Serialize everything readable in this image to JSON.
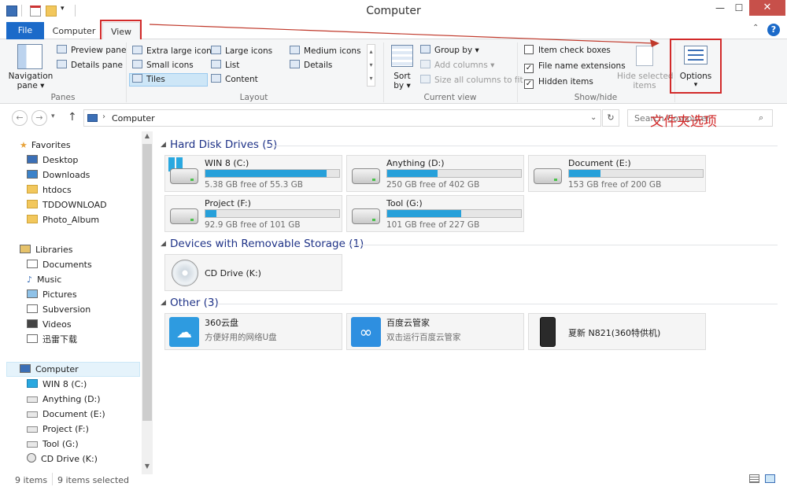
{
  "window": {
    "title": "Computer"
  },
  "tabs": {
    "file": "File",
    "computer": "Computer",
    "view": "View"
  },
  "ribbon": {
    "panes": {
      "navigation_pane": "Navigation",
      "navigation_pane_2": "pane ▾",
      "preview_pane": "Preview pane",
      "details_pane": "Details pane",
      "label": "Panes"
    },
    "layout": {
      "items": [
        "Extra large icons",
        "Large icons",
        "Medium icons",
        "Small icons",
        "List",
        "Details",
        "Tiles",
        "Content"
      ],
      "label": "Layout"
    },
    "current_view": {
      "sort_by": "Sort",
      "sort_by_2": "by ▾",
      "group_by": "Group by ▾",
      "add_columns": "Add columns ▾",
      "size_columns": "Size all columns to fit",
      "label": "Current view"
    },
    "show_hide": {
      "item_check_boxes": "Item check boxes",
      "file_name_extensions": "File name extensions",
      "hidden_items": "Hidden items",
      "hide_selected": "Hide selected",
      "hide_selected_2": "items",
      "label": "Show/hide",
      "checks": {
        "item_check_boxes": "",
        "file_name_extensions": "✓",
        "hidden_items": "✓"
      }
    },
    "options": {
      "label": "Options",
      "arrow": "▾"
    }
  },
  "annotation": {
    "options_label": "文件夹选项"
  },
  "address": {
    "path": "Computer",
    "search_placeholder": "Search Computer"
  },
  "nav": {
    "favorites": "Favorites",
    "desktop": "Desktop",
    "downloads": "Downloads",
    "htdocs": "htdocs",
    "tddownload": "TDDOWNLOAD",
    "photo_album": "Photo_Album",
    "libraries": "Libraries",
    "documents": "Documents",
    "music": "Music",
    "pictures": "Pictures",
    "subversion": "Subversion",
    "videos": "Videos",
    "thunder": "迅雷下载",
    "computer": "Computer",
    "win8": "WIN 8 (C:)",
    "anything": "Anything (D:)",
    "document": "Document (E:)",
    "project": "Project (F:)",
    "tool": "Tool (G:)",
    "cd": "CD Drive (K:)"
  },
  "sections": {
    "hdd": "Hard Disk Drives (5)",
    "removable": "Devices with Removable Storage (1)",
    "other": "Other (3)"
  },
  "drives": [
    {
      "name": "WIN 8 (C:)",
      "free": "5.38 GB free of 55.3 GB",
      "used_fraction": 0.903
    },
    {
      "name": "Anything (D:)",
      "free": "250 GB free of 402 GB",
      "used_fraction": 0.378
    },
    {
      "name": "Document (E:)",
      "free": "153 GB free of 200 GB",
      "used_fraction": 0.235
    },
    {
      "name": "Project (F:)",
      "free": "92.9 GB free of 101 GB",
      "used_fraction": 0.08
    },
    {
      "name": "Tool (G:)",
      "free": "101 GB free of 227 GB",
      "used_fraction": 0.555
    }
  ],
  "removable": {
    "name": "CD Drive (K:)"
  },
  "other": [
    {
      "name": "360云盘",
      "desc": "方便好用的网络U盘"
    },
    {
      "name": "百度云管家",
      "desc": "双击运行百度云管家"
    },
    {
      "name": "夏新 N821(360特供机)",
      "desc": ""
    }
  ],
  "status": {
    "items": "9 items",
    "selected": "9 items selected"
  },
  "colors": {
    "accent": "#1b6ac9",
    "highlight": "#d22a2a",
    "progress": "#26a0da"
  }
}
